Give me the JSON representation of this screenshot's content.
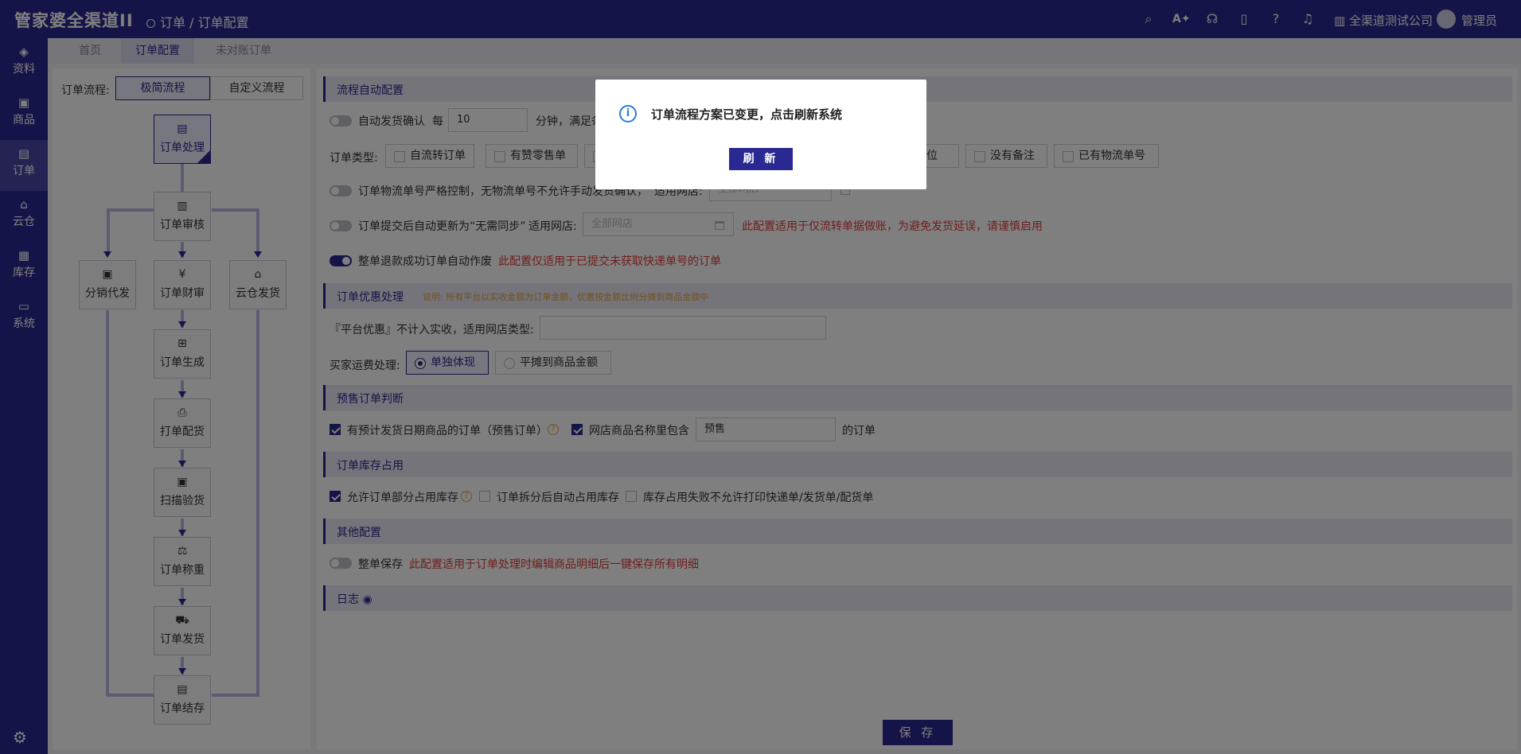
{
  "app": {
    "logo": "管家婆全渠道II",
    "breadcrumb": "订单 / 订单配置",
    "company": "全渠道测试公司",
    "user": "管理员"
  },
  "sidebar": {
    "items": [
      {
        "label": "资料"
      },
      {
        "label": "商品"
      },
      {
        "label": "订单"
      },
      {
        "label": "云仓"
      },
      {
        "label": "库存"
      },
      {
        "label": "系统"
      }
    ]
  },
  "tabs": [
    {
      "label": "首页"
    },
    {
      "label": "订单配置"
    },
    {
      "label": "未对账订单"
    }
  ],
  "flow": {
    "label": "订单流程:",
    "mode_simple": "极简流程",
    "mode_custom": "自定义流程",
    "nodes": {
      "process": "订单处理",
      "audit": "订单审核",
      "distribute": "分销代发",
      "finance": "订单财审",
      "cloud": "云仓发货",
      "generate": "订单生成",
      "print": "打单配货",
      "scan": "扫描验货",
      "weigh": "订单称重",
      "ship": "订单发货",
      "settle": "订单结存"
    }
  },
  "sections": {
    "auto": {
      "title": "流程自动配置",
      "auto_ship": {
        "label": "自动发货确认",
        "every": "每",
        "value": "10",
        "unit": "分钟，满足条"
      },
      "order_type": {
        "label": "订单类型:",
        "opt1": "自流转订单",
        "opt2": "有赞零售单",
        "opt3": "缺货位",
        "opt4": "没有备注",
        "opt5": "已有物流单号"
      },
      "logistics": {
        "label": "订单物流单号严格控制，无物流单号不允许手动发货确认，",
        "shop_label": "适用网店:",
        "shop_placeholder": "全部网店"
      },
      "nosync": {
        "label": "订单提交后自动更新为“无需同步”",
        "shop_label": "适用网店:",
        "shop_placeholder": "全部网店",
        "note": "此配置适用于仅流转单据做账，为避免发货延误，请谨慎启用"
      },
      "refund": {
        "label": "整单退款成功订单自动作废",
        "note": "此配置仅适用于已提交未获取快递单号的订单"
      }
    },
    "discount": {
      "title": "订单优惠处理",
      "note": "说明: 所有平台以实收金额为订单金额，优惠按金额比例分摊到商品金额中",
      "platform_label": "『平台优惠』不计入实收，适用网店类型:",
      "freight_label": "买家运费处理:",
      "freight_opt1": "单独体现",
      "freight_opt2": "平摊到商品金额"
    },
    "presale": {
      "title": "预售订单判断",
      "opt1": "有预计发货日期商品的订单（预售订单）",
      "opt2": "网店商品名称里包含",
      "keyword": "预售",
      "suffix": "的订单"
    },
    "stock": {
      "title": "订单库存占用",
      "opt1": "允许订单部分占用库存",
      "opt2": "订单拆分后自动占用库存",
      "opt3": "库存占用失败不允许打印快递单/发货单/配货单"
    },
    "other": {
      "title": "其他配置",
      "save_all": "整单保存",
      "note": "此配置适用于订单处理时编辑商品明细后一键保存所有明细"
    },
    "log": {
      "title": "日志"
    }
  },
  "save_button": "保 存",
  "modal": {
    "message": "订单流程方案已变更，点击刷新系统",
    "button": "刷 新"
  }
}
